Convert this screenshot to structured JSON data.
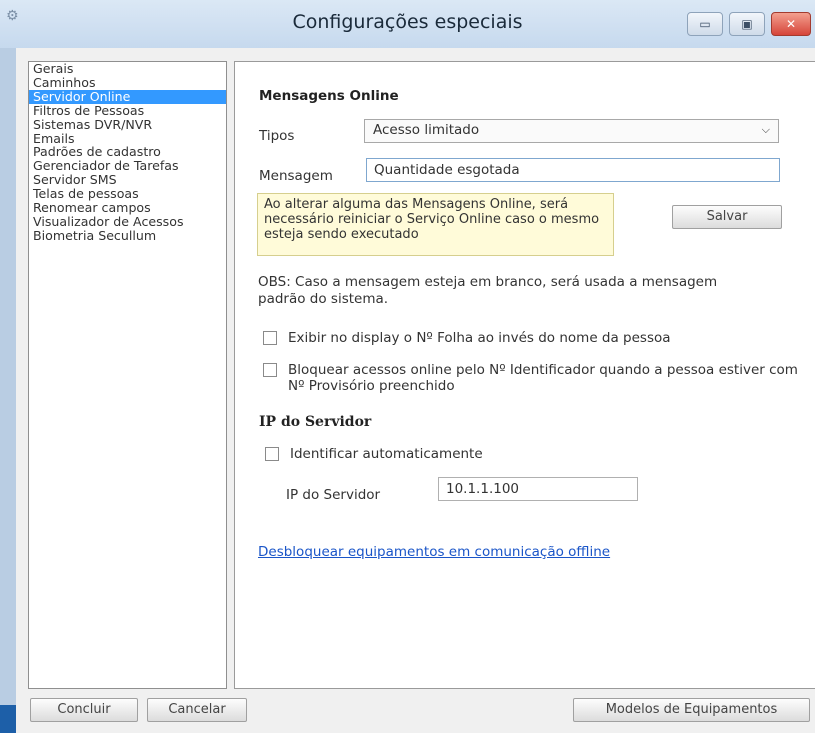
{
  "window": {
    "title": "Configurações especiais",
    "icon": "gear-icon",
    "minimize_glyph": "▭",
    "maximize_glyph": "▣",
    "close_glyph": "✕"
  },
  "nav": {
    "items": [
      {
        "label": "Gerais"
      },
      {
        "label": "Caminhos"
      },
      {
        "label": "Servidor Online",
        "selected": true
      },
      {
        "label": "Filtros de Pessoas"
      },
      {
        "label": "Sistemas DVR/NVR"
      },
      {
        "label": "Emails"
      },
      {
        "label": "Padrões de cadastro"
      },
      {
        "label": "Gerenciador de Tarefas"
      },
      {
        "label": "Servidor SMS"
      },
      {
        "label": "Telas de pessoas"
      },
      {
        "label": "Renomear campos"
      },
      {
        "label": "Visualizador de Acessos"
      },
      {
        "label": "Biometria Secullum"
      }
    ]
  },
  "messages": {
    "heading": "Mensagens Online",
    "types_label": "Tipos",
    "types_value": "Acesso limitado",
    "message_label": "Mensagem",
    "message_value": "Quantidade esgotada",
    "warning": "Ao alterar alguma das Mensagens Online, será necessário reiniciar o Serviço Online caso o mesmo esteja sendo executado",
    "save_label": "Salvar",
    "obs": "OBS: Caso a mensagem esteja em branco, será usada a mensagem padrão do sistema."
  },
  "options": {
    "show_folha": {
      "label": "Exibir no display o Nº Folha ao invés do nome da pessoa",
      "checked": false
    },
    "block_online": {
      "label": "Bloquear acessos online pelo Nº Identificador quando a pessoa estiver com Nº Provisório preenchido",
      "checked": false
    }
  },
  "server": {
    "heading": "IP do Servidor",
    "auto_label": "Identificar automaticamente",
    "auto_checked": false,
    "ip_label": "IP do Servidor",
    "ip_value": "10.1.1.100"
  },
  "link_unblock": "Desbloquear equipamentos em comunicação offline",
  "footer": {
    "conclude": "Concluir",
    "cancel": "Cancelar",
    "models": "Modelos de Equipamentos"
  },
  "colors": {
    "selection": "#3399ff",
    "link": "#1a55c8",
    "warning_bg": "#fffbd9"
  }
}
